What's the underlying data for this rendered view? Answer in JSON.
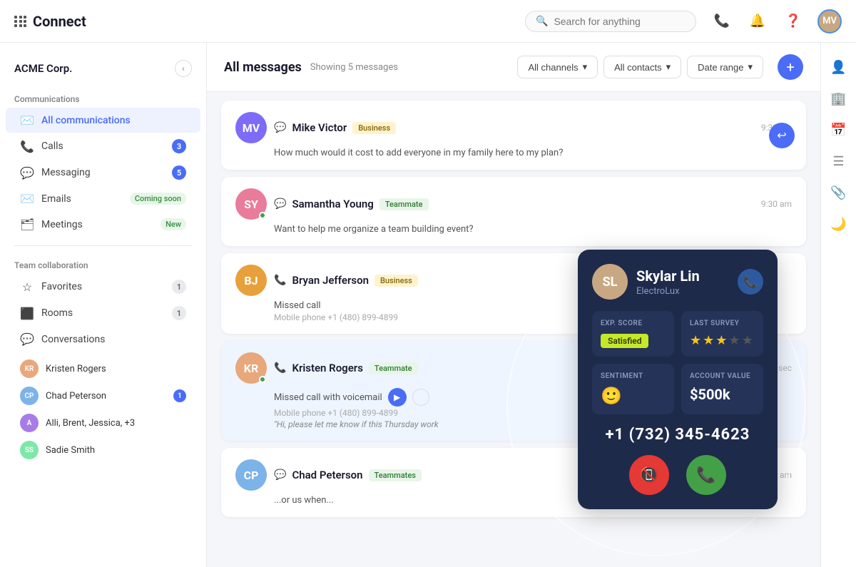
{
  "app": {
    "name": "Connect",
    "logo_grid": true
  },
  "navbar": {
    "search_placeholder": "Search for anything",
    "avatar_initials": "MV"
  },
  "sidebar": {
    "org_name": "ACME Corp.",
    "communications_label": "Communications",
    "nav_items": [
      {
        "id": "all-communications",
        "label": "All communications",
        "icon": "✉",
        "badge": null,
        "active": true
      },
      {
        "id": "calls",
        "label": "Calls",
        "icon": "📞",
        "badge": "3",
        "active": false
      },
      {
        "id": "messaging",
        "label": "Messaging",
        "icon": "💬",
        "badge": "5",
        "active": false
      },
      {
        "id": "emails",
        "label": "Emails",
        "icon": "📧",
        "badge_text": "Coming soon",
        "active": false
      },
      {
        "id": "meetings",
        "label": "Meetings",
        "icon": "🗂",
        "badge_text": "New",
        "active": false
      }
    ],
    "team_label": "Team collaboration",
    "team_items": [
      {
        "id": "favorites",
        "label": "Favorites",
        "icon": "☆",
        "badge": "1"
      },
      {
        "id": "rooms",
        "label": "Rooms",
        "icon": "⬛",
        "badge": "1"
      },
      {
        "id": "conversations",
        "label": "Conversations",
        "icon": "💬",
        "badge": null
      }
    ],
    "users": [
      {
        "name": "Kristen Rogers",
        "initials": "KR",
        "color": "#e8a87c",
        "badge": null
      },
      {
        "name": "Chad Peterson",
        "initials": "CP",
        "color": "#7cb3e8",
        "badge": "1"
      },
      {
        "name": "Alli, Brent, Jessica, +3",
        "initials": "A",
        "color": "#a87ce8",
        "badge": null
      },
      {
        "name": "Sadie Smith",
        "initials": "SS",
        "color": "#7ce8a8",
        "badge": null
      }
    ]
  },
  "content_header": {
    "title": "All messages",
    "showing_text": "Showing 5 messages",
    "filters": [
      {
        "label": "All channels",
        "has_arrow": true
      },
      {
        "label": "All contacts",
        "has_arrow": true
      },
      {
        "label": "Date range",
        "has_arrow": true
      }
    ],
    "add_btn": "+"
  },
  "messages": [
    {
      "id": "msg-1",
      "name": "Mike Victor",
      "tag": "Business",
      "tag_type": "business",
      "avatar_initials": "MV",
      "avatar_color": "#7c6cf7",
      "time": "9:30 am",
      "body": "How much would it cost to add everyone in my family here to my plan?",
      "icon_type": "message",
      "has_reply": true
    },
    {
      "id": "msg-2",
      "name": "Samantha Young",
      "tag": "Teammate",
      "tag_type": "teammate",
      "avatar_initials": "SY",
      "avatar_color": "#e87c9a",
      "time": "9:30 am",
      "body": "Want to help me organize a team building event?",
      "icon_type": "message",
      "has_reply": false,
      "has_online": true
    },
    {
      "id": "msg-3",
      "name": "Bryan Jefferson",
      "tag": "Business",
      "tag_type": "business",
      "avatar_initials": "BJ",
      "avatar_color": "#e8a03c",
      "time": "",
      "body": "Missed call",
      "sub_body": "Mobile phone +1 (480) 899-4899",
      "icon_type": "phone",
      "has_reply": false
    },
    {
      "id": "msg-4",
      "name": "Kristen Rogers",
      "tag": "Teammate",
      "tag_type": "teammate",
      "avatar_initials": "KR",
      "avatar_color": "#e8a87c",
      "time": "15 sec",
      "body": "Missed call with voicemail",
      "sub_body": "Mobile phone +1 (480) 899-4899",
      "quote": "\"Hi, please let me know if this Thursday work",
      "icon_type": "phone",
      "has_reply": false,
      "has_online": true,
      "has_voicemail": true
    },
    {
      "id": "msg-5",
      "name": "Chad Peterson",
      "tag": "Teammates",
      "tag_type": "teammates",
      "avatar_initials": "CP",
      "avatar_color": "#7cb3e8",
      "time": "9:30 am",
      "body": "...or us when...",
      "icon_type": "message",
      "has_reply": false
    }
  ],
  "call_card": {
    "name": "Skylar Lin",
    "company": "ElectroLux",
    "avatar_initials": "SL",
    "avatar_color": "#c8a882",
    "exp_score_label": "EXP. SCORE",
    "exp_score_value": "Satisfied",
    "last_survey_label": "LAST SURVEY",
    "stars_filled": 3,
    "stars_total": 5,
    "sentiment_label": "SENTIMENT",
    "sentiment_emoji": "🙂",
    "account_value_label": "ACCOUNT VALUE",
    "account_value": "$500k",
    "phone_number": "+1 (732) 345-4623",
    "decline_icon": "📵",
    "accept_icon": "📞"
  },
  "right_panel_icons": [
    {
      "id": "user-icon",
      "symbol": "👤"
    },
    {
      "id": "building-icon",
      "symbol": "🏢"
    },
    {
      "id": "calendar-icon",
      "symbol": "📅"
    },
    {
      "id": "list-icon",
      "symbol": "☰"
    },
    {
      "id": "clip-icon",
      "symbol": "📎"
    },
    {
      "id": "moon-icon",
      "symbol": "🌙"
    }
  ]
}
